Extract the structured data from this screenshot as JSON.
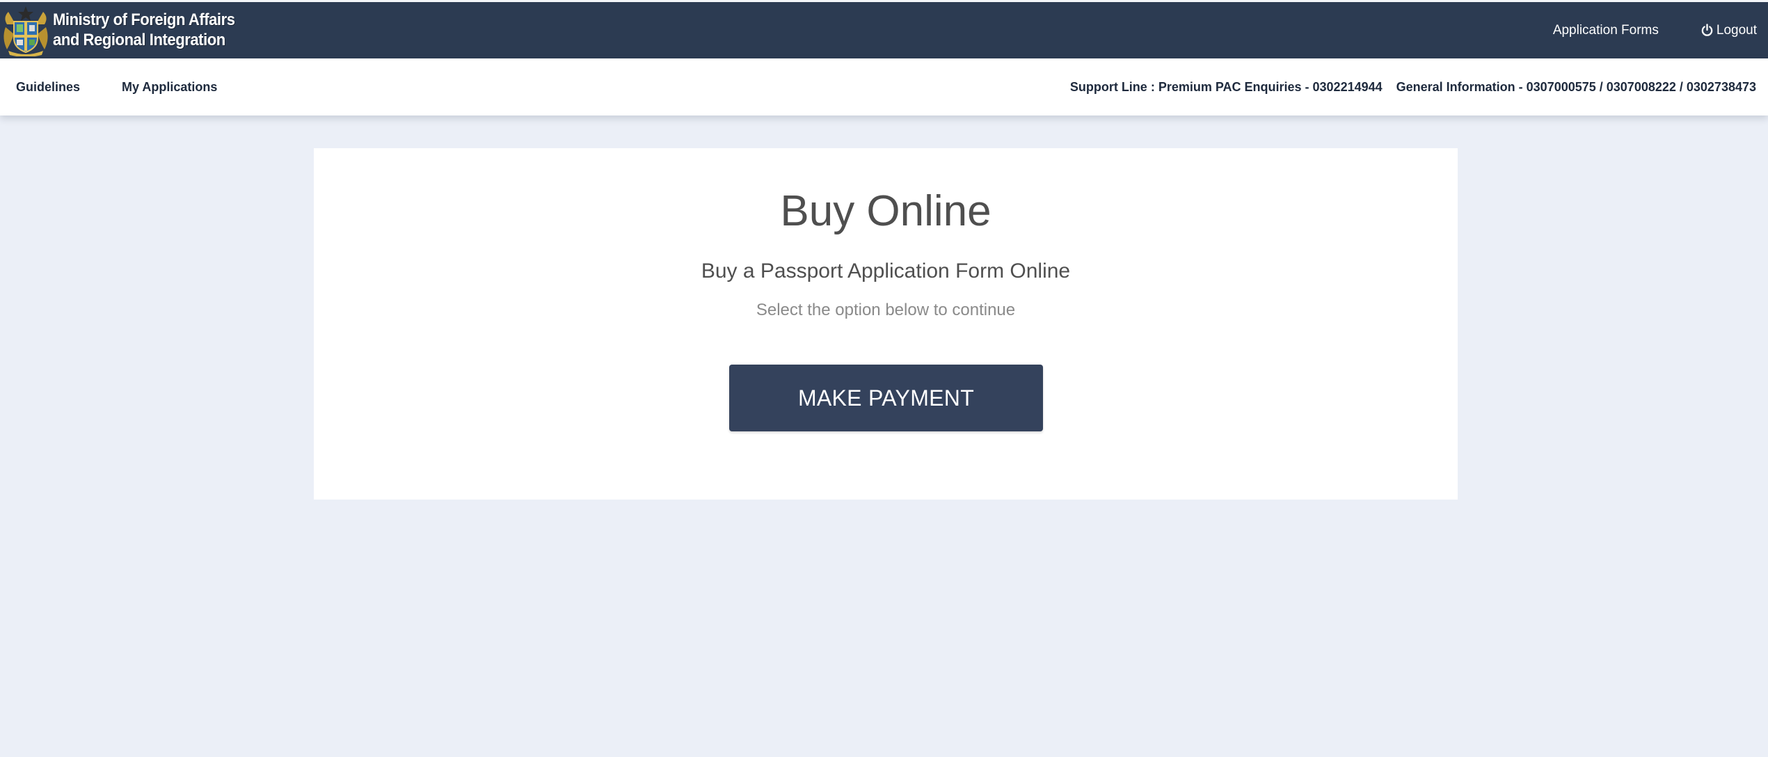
{
  "header": {
    "brand_line1": "Ministry of Foreign Affairs",
    "brand_line2": "and Regional Integration",
    "crest_icon": "ghana-coat-of-arms-icon",
    "application_forms_label": "Application Forms",
    "logout_label": "Logout",
    "logout_icon": "power-icon",
    "background_color": "#2c3b52"
  },
  "subnav": {
    "guidelines_label": "Guidelines",
    "my_applications_label": "My Applications",
    "support_line": "Support Line : Premium PAC Enquiries - 0302214944",
    "general_information": "General Information - 0307000575 / 0307008222 / 0302738473"
  },
  "main": {
    "title": "Buy Online",
    "subtitle": "Buy a Passport Application Form Online",
    "hint": "Select the option below to continue",
    "button_label": "MAKE PAYMENT",
    "button_color": "#34425c",
    "page_background": "#ebeff7"
  }
}
